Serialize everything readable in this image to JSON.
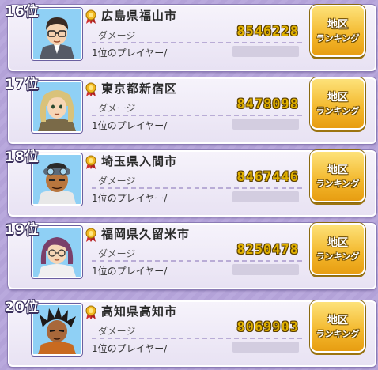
{
  "colors": {
    "damage_value": "#e0b000",
    "button": "#f3b72b",
    "background": "#b9a9dd"
  },
  "rows": [
    {
      "rank": "16位",
      "city": "広島県福山市",
      "damage_label": "ダメージ",
      "damage_value": "8546228",
      "player_label": "1位のプレイヤー/",
      "button": {
        "line1": "地区",
        "line2": "ランキング"
      },
      "avatar_icon": "man-glasses-portrait-icon"
    },
    {
      "rank": "17位",
      "city": "東京都新宿区",
      "damage_label": "ダメージ",
      "damage_value": "8478098",
      "player_label": "1位のプレイヤー/",
      "button": {
        "line1": "地区",
        "line2": "ランキング"
      },
      "avatar_icon": "woman-blonde-portrait-icon"
    },
    {
      "rank": "18位",
      "city": "埼玉県入間市",
      "damage_label": "ダメージ",
      "damage_value": "8467446",
      "player_label": "1位のプレイヤー/",
      "button": {
        "line1": "地区",
        "line2": "ランキング"
      },
      "avatar_icon": "man-goggles-portrait-icon"
    },
    {
      "rank": "19位",
      "city": "福岡県久留米市",
      "damage_label": "ダメージ",
      "damage_value": "8250478",
      "player_label": "1位のプレイヤー/",
      "button": {
        "line1": "地区",
        "line2": "ランキング"
      },
      "avatar_icon": "woman-purple-hair-portrait-icon"
    },
    {
      "rank": "20位",
      "city": "高知県高知市",
      "damage_label": "ダメージ",
      "damage_value": "8069903",
      "player_label": "1位のプレイヤー/",
      "button": {
        "line1": "地区",
        "line2": "ランキング"
      },
      "avatar_icon": "boy-spiky-hair-portrait-icon"
    }
  ]
}
